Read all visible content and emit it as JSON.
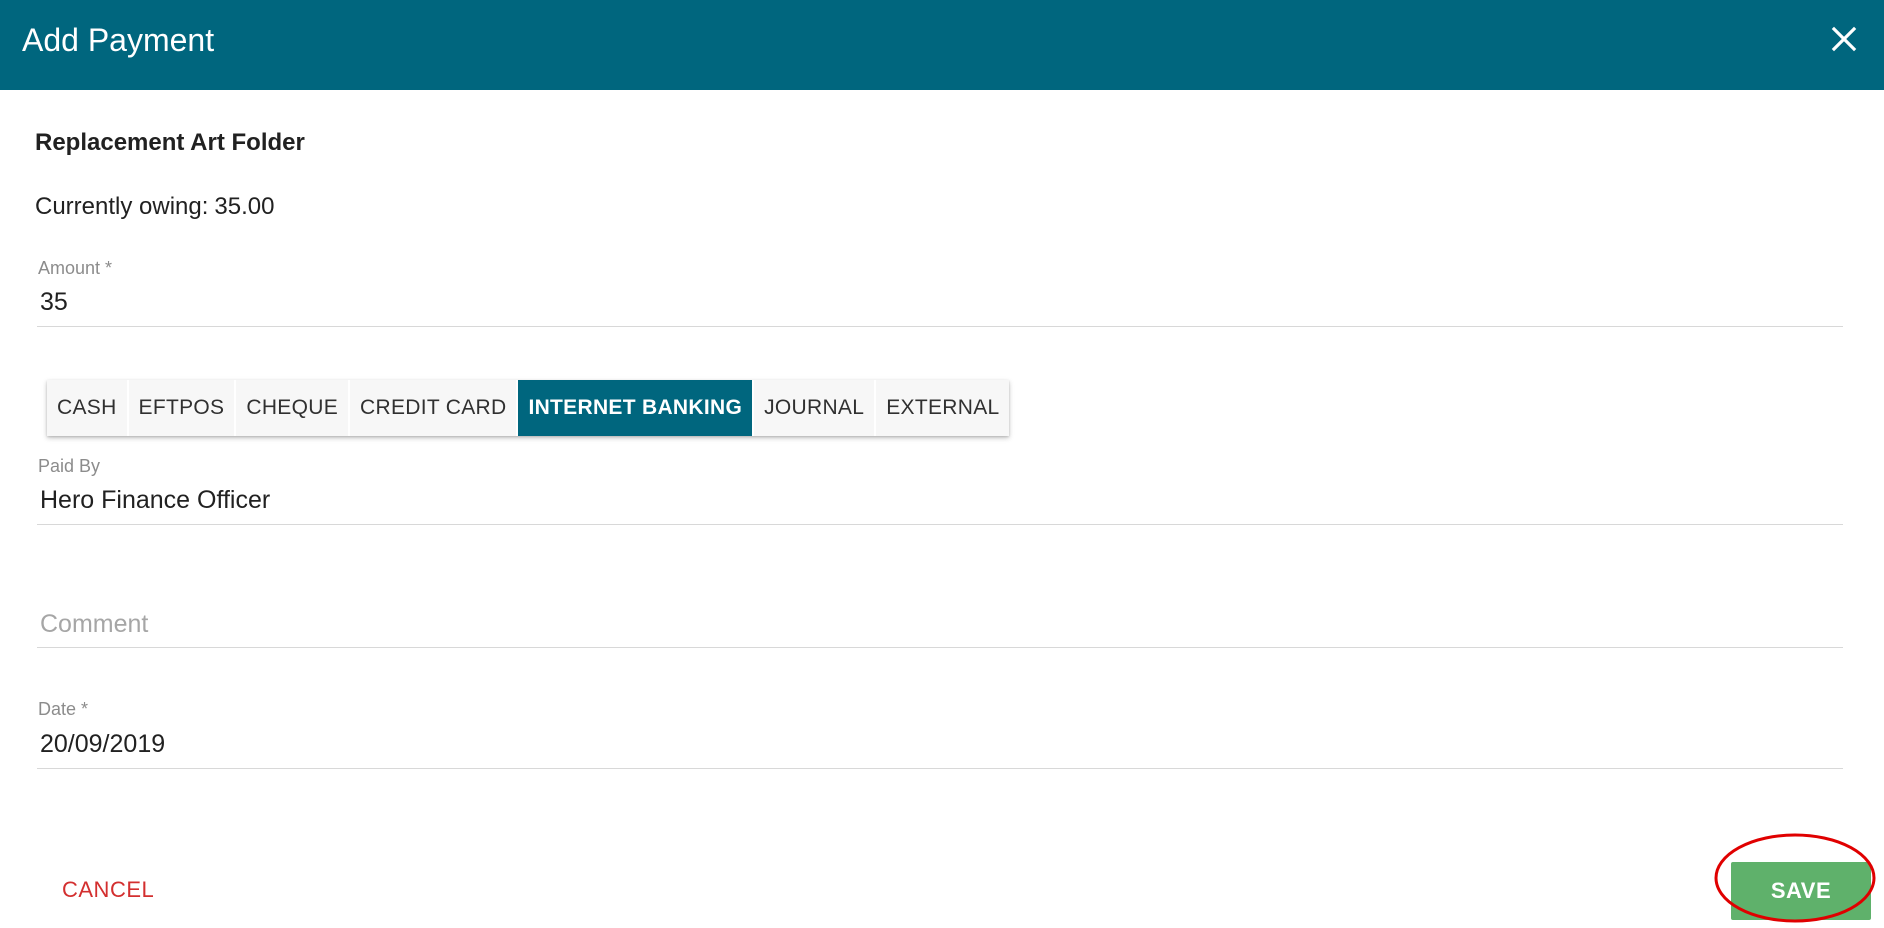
{
  "dialog": {
    "title": "Add Payment",
    "colors": {
      "header": "#00667e",
      "active_method": "#00667e",
      "save": "#5fb16b",
      "cancel": "#d32f2f",
      "highlight": "#e00000"
    }
  },
  "item": {
    "title": "Replacement Art Folder",
    "owing_label": "Currently owing:",
    "owing_value": "35.00"
  },
  "fields": {
    "amount": {
      "label": "Amount *",
      "value": "35"
    },
    "paid_by": {
      "label": "Paid By",
      "value": "Hero Finance Officer"
    },
    "comment": {
      "placeholder": "Comment",
      "value": ""
    },
    "date": {
      "label": "Date *",
      "value": "20/09/2019"
    }
  },
  "methods": {
    "items": [
      "CASH",
      "EFTPOS",
      "CHEQUE",
      "CREDIT CARD",
      "INTERNET BANKING",
      "JOURNAL",
      "EXTERNAL"
    ],
    "active": "INTERNET BANKING"
  },
  "actions": {
    "cancel_label": "CANCEL",
    "save_label": "SAVE"
  },
  "icons": {
    "close": "close-icon"
  }
}
